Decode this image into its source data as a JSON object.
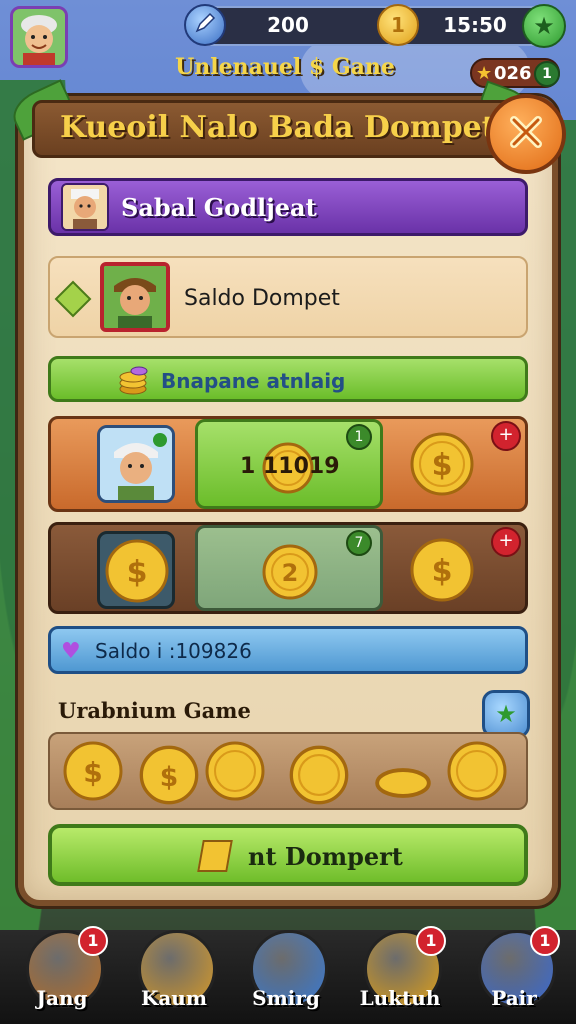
{
  "header": {
    "coins": "200",
    "coin_icon_label": "1",
    "time": "15:50",
    "subtitle": "Unlenauel $ Gane",
    "score": "026",
    "score_badge": "1"
  },
  "panel": {
    "title": "Kueoil Nalo Bada Dompet",
    "profile_label": "Sabal Godljeat",
    "saldo_label": "Saldo Dompet",
    "green_label": "Bnapane atnlaig",
    "row1": {
      "value": "1 11019",
      "badge": "1",
      "plus": "+"
    },
    "row2": {
      "coin_label": "2",
      "badge": "7",
      "plus": "+"
    },
    "saldo_line": "Saldo i :109826",
    "section_title": "Urabnium Game",
    "button_label": "nt Dompert"
  },
  "nav": [
    {
      "label": "Jang",
      "badge": "1",
      "color": "#b8702a"
    },
    {
      "label": "Kaum",
      "badge": "",
      "color": "#d79b2a"
    },
    {
      "label": "Smirg",
      "badge": "",
      "color": "#3a7ad2"
    },
    {
      "label": "Luktuh",
      "badge": "1",
      "color": "#e0a11a"
    },
    {
      "label": "Pair",
      "badge": "1",
      "color": "#3a6ad2"
    }
  ],
  "icons": [
    "pencil-icon",
    "coin-icon",
    "star-icon",
    "close-icon",
    "heart-icon",
    "diamond-icon"
  ],
  "colors": {
    "gold": "#f2c332",
    "green": "#6bbd2a",
    "purple": "#6a32a8",
    "blue": "#4f98d2",
    "red": "#d2232e"
  }
}
